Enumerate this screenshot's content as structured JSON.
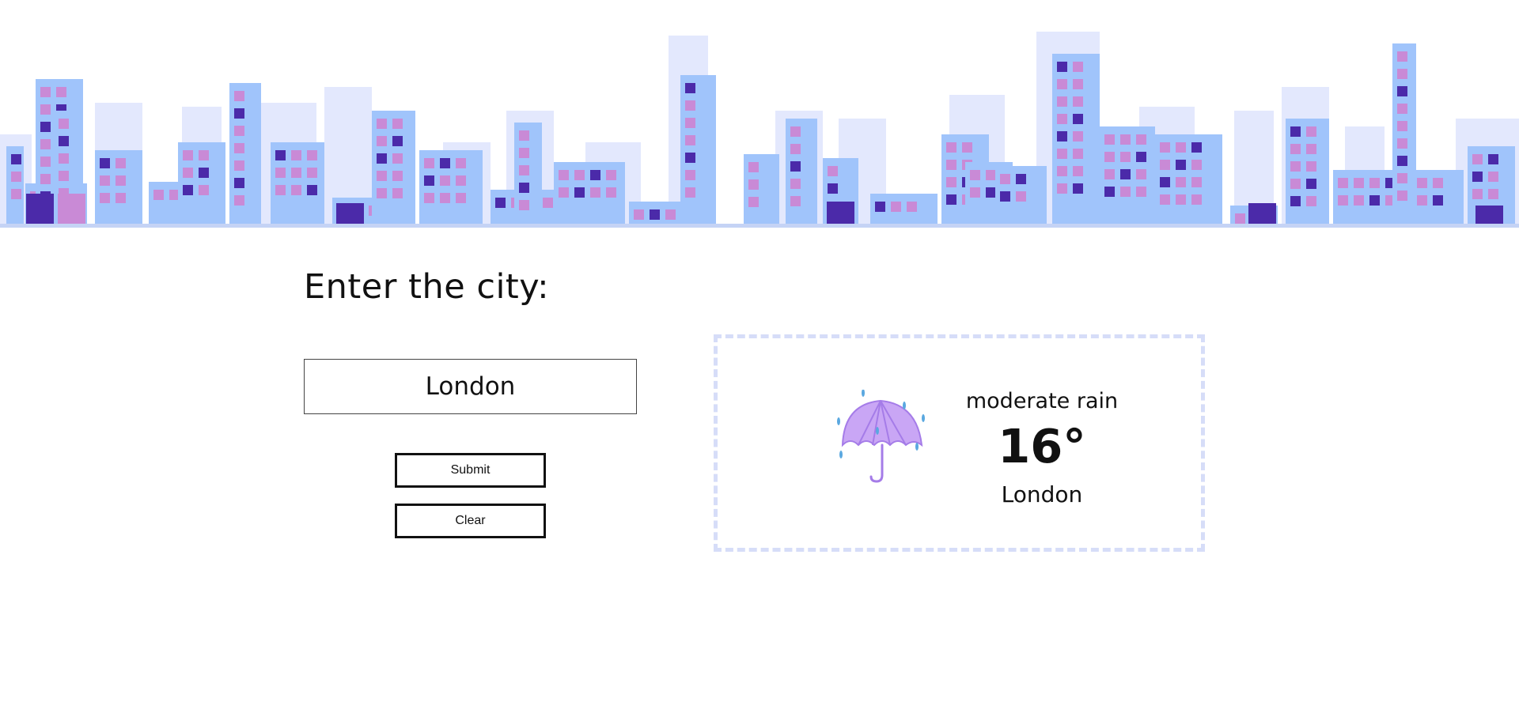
{
  "banner": {
    "image": "city-skyline-illustration",
    "colors": {
      "building_light": "#a0c4fb",
      "building_pale": "#e3e8fd",
      "window_pink": "#c98ad6",
      "window_dark": "#4b2aa9",
      "ground": "#c5d3f5"
    }
  },
  "form": {
    "title": "Enter the city:",
    "city_value": "London",
    "submit_label": "Submit",
    "clear_label": "Clear"
  },
  "weather": {
    "icon": "umbrella-rain-icon",
    "description": "moderate rain",
    "temperature": "16°",
    "city": "London",
    "card_border_color": "#d6ddf8"
  }
}
